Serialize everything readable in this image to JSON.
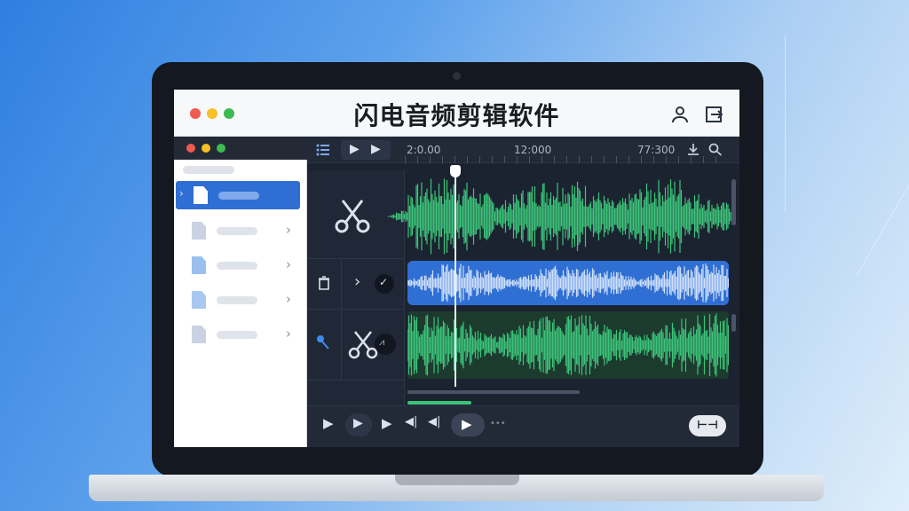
{
  "app": {
    "title": "闪电音频剪辑软件"
  },
  "colors": {
    "accent_blue": "#2f6fd3",
    "wave_green": "#3cc47a",
    "wave_light": "#cfe0fb",
    "editor_bg": "#1c2330"
  },
  "titlebar": {
    "window_controls": [
      "close-dot",
      "minimize-dot",
      "maximize-dot"
    ],
    "right_icons": [
      "user-icon",
      "export-icon"
    ]
  },
  "sidebar": {
    "items": [
      {
        "icon": "file-icon",
        "active": true
      },
      {
        "icon": "file-icon",
        "active": false
      },
      {
        "icon": "file-icon",
        "active": false
      },
      {
        "icon": "file-icon",
        "active": false
      },
      {
        "icon": "file-icon",
        "active": false
      }
    ]
  },
  "timeline": {
    "ticks": [
      "2:0.00",
      "12:000",
      "77:300"
    ],
    "toolbar_icons": [
      "list-icon",
      "play-icon",
      "play-next-icon",
      "download-icon",
      "search-icon"
    ]
  },
  "tracks": [
    {
      "tool_icon": "scissors-icon",
      "clip_color": "green"
    },
    {
      "tool_icons": [
        "trash-icon",
        "chevron-right-icon",
        "check-icon"
      ],
      "clip_color": "blue"
    },
    {
      "tool_icons": [
        "mic-icon",
        "scissors-icon",
        "chart-icon"
      ],
      "clip_color": "green"
    }
  ],
  "playback": {
    "progress": 0.2,
    "end_button_label": "⊢⊣"
  }
}
